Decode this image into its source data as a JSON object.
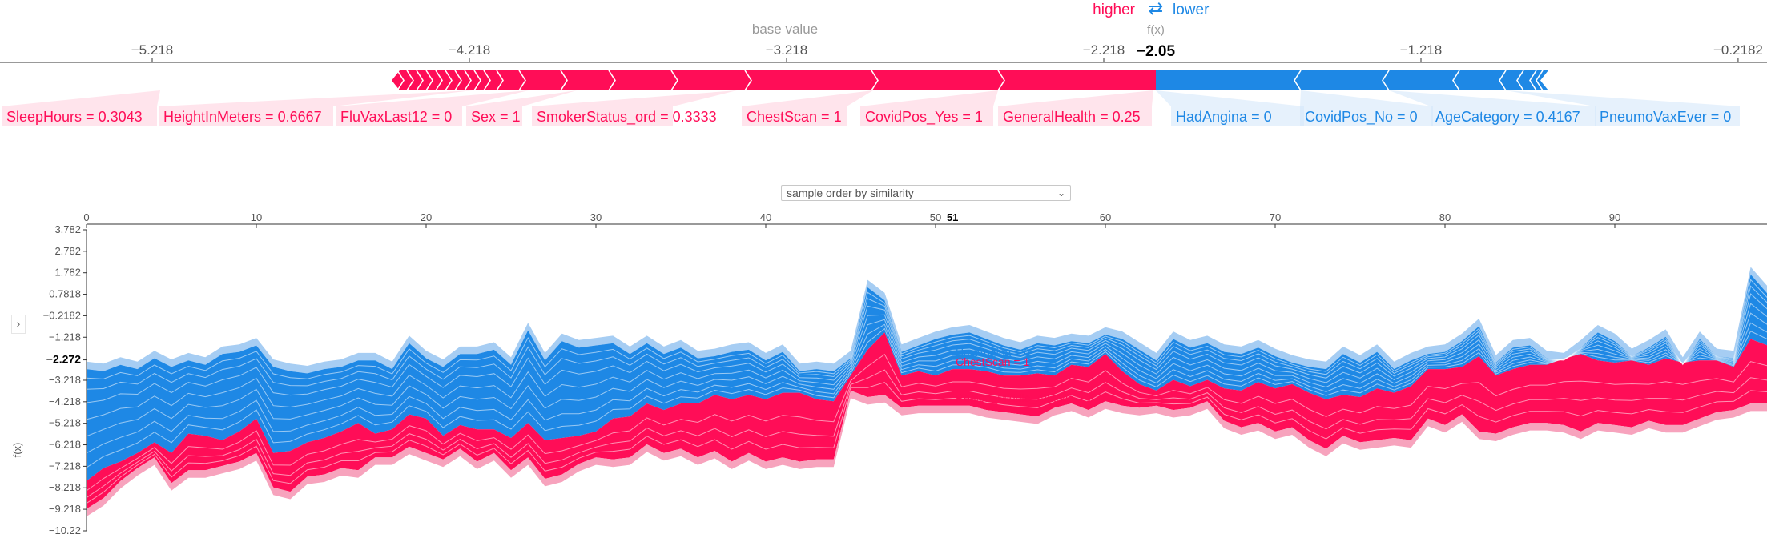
{
  "force_plot": {
    "legend_higher": "higher",
    "legend_arrows": "⇄",
    "legend_lower": "lower",
    "fx_label": "f(x)",
    "fx_value": "−2.05",
    "base_value_label": "base value",
    "base_value": -3.218,
    "axis_ticks": [
      "−5.218",
      "−4.218",
      "−3.218",
      "−2.218",
      "−1.218",
      "−0.2182"
    ],
    "axis_values": [
      -5.218,
      -4.218,
      -3.218,
      -2.218,
      -1.218,
      -0.2182
    ],
    "positive_features": [
      "SleepHours = 0.3043",
      "HeightInMeters = 0.6667",
      "FluVaxLast12 = 0",
      "Sex = 1",
      "SmokerStatus_ord = 0.3333",
      "ChestScan = 1",
      "CovidPos_Yes = 1",
      "GeneralHealth = 0.25"
    ],
    "negative_features": [
      "HadAngina = 0",
      "CovidPos_No = 0",
      "AgeCategory = 0.4167",
      "PneumoVaxEver = 0"
    ]
  },
  "controls": {
    "order_select": "sample order by similarity",
    "expand_glyph": "›"
  },
  "colors": {
    "positive": "#ff0d57",
    "negative": "#1e88e5",
    "positive_light": "#ffc3d5",
    "negative_light": "#d1e6fa",
    "axis": "#333333"
  },
  "chart_data": {
    "type": "area",
    "xlabel": "",
    "ylabel": "f(x)",
    "x_ticks": [
      "0",
      "10",
      "20",
      "30",
      "40",
      "50",
      "60",
      "70",
      "80",
      "90"
    ],
    "x_highlight": "51",
    "ylim": [
      -10.22,
      3.782
    ],
    "y_ticks": [
      "3.782",
      "2.782",
      "1.782",
      "0.7818",
      "−0.2182",
      "−1.218",
      "−2.272",
      "−3.218",
      "−4.218",
      "−5.218",
      "−6.218",
      "−7.218",
      "−8.218",
      "−9.218",
      "−10.22"
    ],
    "y_tick_values": [
      3.782,
      2.782,
      1.782,
      0.7818,
      -0.2182,
      -1.218,
      -2.272,
      -3.218,
      -4.218,
      -5.218,
      -6.218,
      -7.218,
      -8.218,
      -9.218,
      -10.22
    ],
    "hover_labels": [
      "HadAngina = 0",
      "ChestScan = 1",
      "Region_Middle_Atlantic = 1"
    ],
    "top": [
      -2.7,
      -2.8,
      -2.5,
      -2.7,
      -2.2,
      -2.6,
      -2.3,
      -2.5,
      -2.0,
      -1.9,
      -1.6,
      -2.6,
      -2.8,
      -2.9,
      -2.7,
      -2.6,
      -2.3,
      -2.3,
      -2.7,
      -1.5,
      -2.2,
      -2.6,
      -2.0,
      -2.0,
      -1.8,
      -2.5,
      -0.9,
      -2.3,
      -1.4,
      -1.7,
      -1.6,
      -1.5,
      -2.0,
      -1.5,
      -2.0,
      -1.7,
      -2.2,
      -2.1,
      -1.9,
      -1.8,
      -2.3,
      -1.9,
      -2.8,
      -2.7,
      -2.8,
      -2.2,
      1.1,
      0.5,
      -1.9,
      -1.6,
      -1.3,
      -1.1,
      -1.0,
      -1.3,
      -1.6,
      -1.8,
      -1.5,
      -1.6,
      -1.4,
      -1.5,
      -1.1,
      -1.3,
      -1.8,
      -2.3,
      -1.3,
      -1.7,
      -1.5,
      -1.9,
      -2.0,
      -1.7,
      -2.1,
      -2.4,
      -2.6,
      -2.7,
      -2.0,
      -2.4,
      -1.9,
      -2.7,
      -2.3,
      -2.0,
      -1.9,
      -1.4,
      -0.7,
      -2.4,
      -1.7,
      -1.6,
      -2.2,
      -2.3,
      -1.7,
      -1.0,
      -1.4,
      -2.1,
      -1.7,
      -1.2,
      -2.5,
      -1.3,
      -2.1,
      -2.2,
      1.7,
      0.8,
      2.6
    ],
    "mid": [
      -7.9,
      -7.3,
      -7.0,
      -6.6,
      -6.1,
      -6.6,
      -5.7,
      -5.8,
      -6.0,
      -5.6,
      -5.0,
      -6.6,
      -6.5,
      -6.1,
      -5.9,
      -5.6,
      -5.2,
      -5.7,
      -5.5,
      -4.8,
      -5.0,
      -5.8,
      -5.3,
      -5.5,
      -5.5,
      -5.9,
      -5.2,
      -6.0,
      -5.9,
      -5.8,
      -5.6,
      -5.0,
      -4.9,
      -4.3,
      -4.6,
      -4.3,
      -4.3,
      -3.9,
      -4.1,
      -3.9,
      -4.1,
      -3.8,
      -3.8,
      -4.1,
      -4.2,
      -3.0,
      -1.8,
      -1.0,
      -3.0,
      -2.8,
      -3.0,
      -2.7,
      -2.7,
      -2.8,
      -3.0,
      -3.0,
      -2.9,
      -3.0,
      -2.5,
      -2.6,
      -2.0,
      -2.8,
      -3.4,
      -3.7,
      -3.2,
      -3.5,
      -3.2,
      -3.6,
      -3.7,
      -3.3,
      -3.6,
      -3.4,
      -3.8,
      -4.1,
      -3.9,
      -4.0,
      -3.6,
      -3.8,
      -3.5,
      -2.7,
      -2.7,
      -2.6,
      -2.1,
      -3.0,
      -2.7,
      -2.5,
      -2.5,
      -2.2,
      -2.0,
      -2.3,
      -2.4,
      -2.3,
      -2.5,
      -2.2,
      -2.4,
      -2.3,
      -2.3,
      -2.6,
      -1.3,
      -1.6,
      -1.4
    ],
    "bottom": [
      -9.2,
      -8.7,
      -7.9,
      -7.3,
      -6.8,
      -8.0,
      -7.4,
      -7.4,
      -7.2,
      -7.0,
      -6.6,
      -8.2,
      -8.4,
      -7.7,
      -7.6,
      -7.3,
      -7.4,
      -6.8,
      -6.8,
      -6.3,
      -6.6,
      -6.9,
      -6.4,
      -7.0,
      -6.6,
      -7.4,
      -6.8,
      -7.8,
      -7.6,
      -7.1,
      -6.8,
      -6.9,
      -6.8,
      -6.2,
      -6.6,
      -6.4,
      -6.8,
      -6.5,
      -7.0,
      -6.6,
      -7.0,
      -6.8,
      -7.0,
      -6.9,
      -6.9,
      -3.7,
      -4.0,
      -3.9,
      -4.5,
      -4.4,
      -4.4,
      -4.4,
      -4.4,
      -4.6,
      -4.7,
      -4.8,
      -4.9,
      -4.5,
      -4.3,
      -4.6,
      -4.2,
      -4.4,
      -4.5,
      -4.4,
      -4.6,
      -4.5,
      -4.2,
      -5.1,
      -5.4,
      -5.2,
      -5.6,
      -5.4,
      -6.0,
      -6.4,
      -5.8,
      -6.1,
      -6.0,
      -5.9,
      -6.0,
      -5.0,
      -5.3,
      -4.8,
      -5.6,
      -5.7,
      -5.4,
      -5.2,
      -5.2,
      -5.3,
      -5.6,
      -5.2,
      -5.3,
      -5.4,
      -5.1,
      -5.3,
      -5.3,
      -5.0,
      -4.7,
      -4.6,
      -4.3,
      -4.3,
      -4.5
    ]
  }
}
